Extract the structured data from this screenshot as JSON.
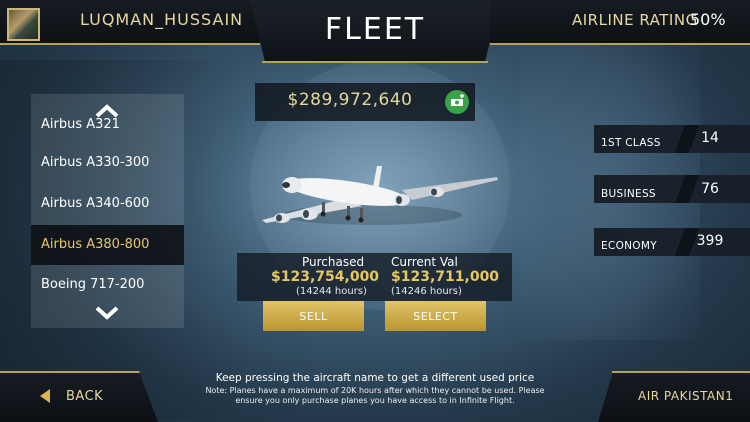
{
  "header": {
    "username": "LUQMAN_HUSSAIN",
    "title": "FLEET",
    "rating_label": "AIRLINE RATING",
    "rating_value": "50%"
  },
  "balance": "$289,972,640",
  "aircraft_list": {
    "items": [
      {
        "label": "Airbus A321",
        "partial": true
      },
      {
        "label": "Airbus A330-300"
      },
      {
        "label": "Airbus A340-600"
      },
      {
        "label": "Airbus A380-800",
        "selected": true
      },
      {
        "label": "Boeing 717-200"
      }
    ]
  },
  "price": {
    "purchased_label": "Purchased",
    "purchased_value": "$123,754,000",
    "purchased_hours": "(14244 hours)",
    "current_label": "Current Val",
    "current_value": "$123,711,000",
    "current_hours": "(14246 hours)"
  },
  "buttons": {
    "sell": "SELL",
    "select": "SELECT"
  },
  "seats": [
    {
      "label": "1ST CLASS",
      "value": "14"
    },
    {
      "label": "BUSINESS",
      "value": "76"
    },
    {
      "label": "ECONOMY",
      "value": "399"
    }
  ],
  "hint": "Keep pressing the aircraft name to get a different used price",
  "note": "Note: Planes have a maximum of 20K hours after which they cannot be used. Please ensure you only purchase planes you have access to in Infinite Flight.",
  "footer": {
    "back": "BACK",
    "airline": "AIR PAKISTAN1"
  },
  "colors": {
    "gold": "#e6c86a",
    "button_gold": "#d4b453",
    "add_money_green": "#3aa34a"
  },
  "icons": {
    "add_money": "money-add-icon",
    "back": "arrow-left-icon",
    "scroll_up": "chevron-up-icon",
    "scroll_down": "chevron-down-icon"
  }
}
